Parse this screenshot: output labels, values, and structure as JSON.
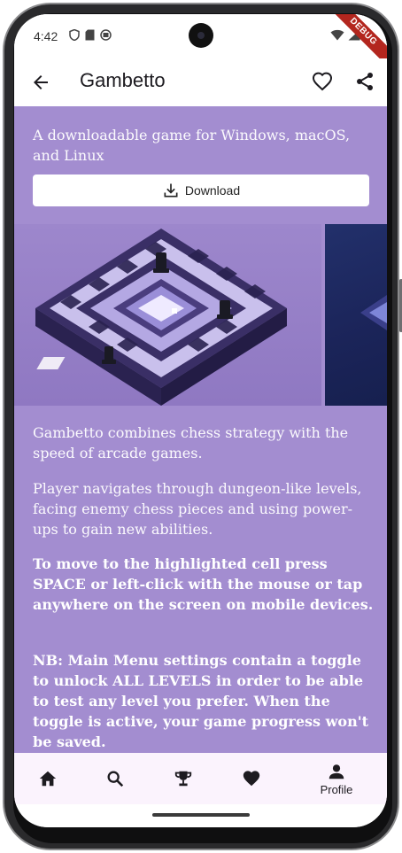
{
  "status_bar": {
    "time": "4:42",
    "debug_label": "DEBUG"
  },
  "app_bar": {
    "title": "Gambetto",
    "back_icon": "arrow-back-icon",
    "favorite_icon": "heart-outline-icon",
    "share_icon": "share-icon"
  },
  "content": {
    "tagline": "A downloadable game for Windows, macOS, and Linux",
    "download_label": "Download",
    "paragraphs": [
      "Gambetto combines chess strategy with the speed of arcade games.",
      "Player navigates through dungeon-like levels, facing enemy chess pieces and using power-ups to gain new abilities."
    ],
    "bold_paragraphs": [
      "To move to the highlighted cell press SPACE or left-click with the mouse or tap anywhere on the screen on mobile devices.",
      "NB: Main Menu settings contain a toggle to unlock ALL LEVELS in order to be able to test any level you prefer. When the toggle is active, your game progress won't be saved."
    ]
  },
  "bottom_nav": {
    "items": [
      {
        "icon": "home-icon",
        "label": ""
      },
      {
        "icon": "search-icon",
        "label": ""
      },
      {
        "icon": "trophy-icon",
        "label": ""
      },
      {
        "icon": "heart-icon",
        "label": ""
      },
      {
        "icon": "person-icon",
        "label": "Profile"
      }
    ]
  },
  "colors": {
    "content_background": "#a38dd0",
    "nav_background": "#fbf3fd",
    "debug_ribbon": "#b3261e"
  }
}
